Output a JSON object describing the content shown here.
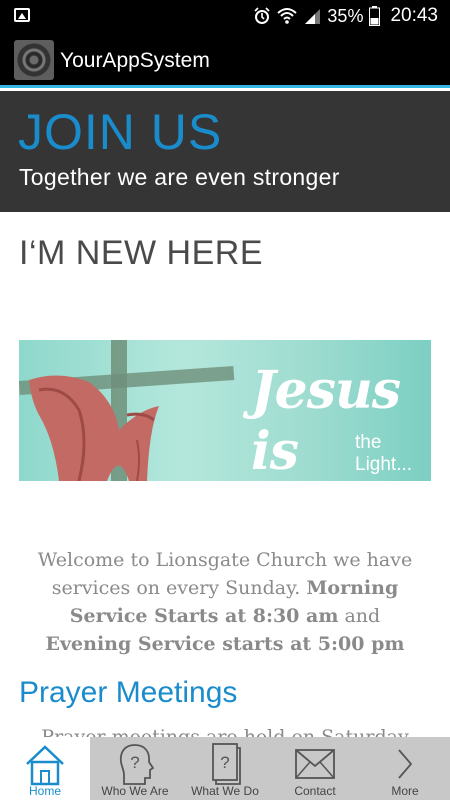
{
  "status_bar": {
    "battery_percent": "35%",
    "time": "20:43"
  },
  "app_bar": {
    "title": "YourAppSystem"
  },
  "hero": {
    "title": "JOIN US",
    "subtitle": "Together we are even stronger"
  },
  "content": {
    "heading": "I‘M NEW HERE",
    "banner": {
      "headline": "Jesus is",
      "tagline": "the Light..."
    },
    "welcome": {
      "line1": "Welcome to Lionsgate Church we have",
      "line2_plain": "services on every Sunday.",
      "line2_bold": "Morning",
      "line3_bold": "Service Starts at 8:30 am",
      "line3_plain": "and",
      "line4_bold": "Evening Service starts at 5:00 pm"
    },
    "section_heading": "Prayer Meetings",
    "cut_off_text": "Prayer meetings are held on Saturday"
  },
  "bottom_nav": {
    "items": [
      {
        "label": "Home",
        "icon": "home-icon",
        "active": true
      },
      {
        "label": "Who We Are",
        "icon": "question-head-icon",
        "active": false
      },
      {
        "label": "What We Do",
        "icon": "question-book-icon",
        "active": false
      },
      {
        "label": "Contact",
        "icon": "envelope-icon",
        "active": false
      },
      {
        "label": "More",
        "icon": "chevron-right-icon",
        "active": false
      }
    ]
  },
  "colors": {
    "accent": "#1a8ccc",
    "app_bar_underline": "#33b5e5",
    "hero_background": "#353535",
    "nav_background": "#c8c8c8"
  }
}
